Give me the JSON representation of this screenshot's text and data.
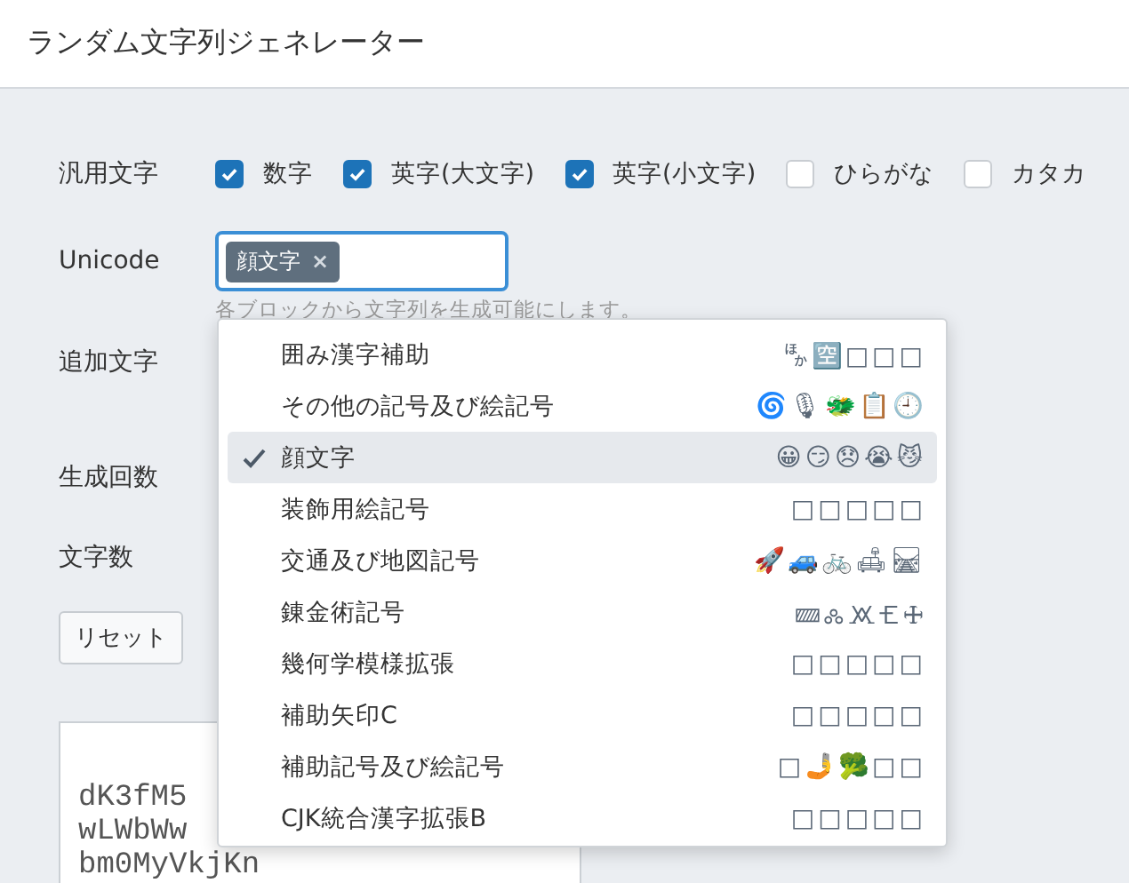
{
  "title": "ランダム文字列ジェネレーター",
  "general": {
    "label": "汎用文字",
    "options": [
      {
        "label": "数字",
        "checked": true
      },
      {
        "label": "英字(大文字)",
        "checked": true
      },
      {
        "label": "英字(小文字)",
        "checked": true
      },
      {
        "label": "ひらがな",
        "checked": false
      },
      {
        "label": "カタカ",
        "checked": false
      }
    ]
  },
  "unicode": {
    "label": "Unicode",
    "tags": [
      {
        "label": "顔文字",
        "remove": "×"
      }
    ],
    "hint": "各ブロックから文字列を生成可能にします。"
  },
  "extra_label": "追加文字",
  "count_label": "生成回数",
  "length_label": "文字数",
  "reset_button": "リセット",
  "output": [
    "dK3fM5",
    "wLWbWw",
    "bm0MyVkjKn"
  ],
  "dropdown": {
    "items": [
      {
        "label": "囲み漢字補助",
        "sample": "🈀🈳□□□",
        "selected": false
      },
      {
        "label": "その他の記号及び絵記号",
        "sample": "🌀🎙🐲📋🕘",
        "selected": false
      },
      {
        "label": "顔文字",
        "sample": "😀😏😞😭😼",
        "selected": true
      },
      {
        "label": "装飾用絵記号",
        "sample": "□□□□□",
        "selected": false
      },
      {
        "label": "交通及び地図記号",
        "sample": "🚀🚙🚲🛋🛤",
        "selected": false
      },
      {
        "label": "錬金術記号",
        "sample": "🝙🝆🝪🝗🜊",
        "selected": false
      },
      {
        "label": "幾何学模様拡張",
        "sample": "□□□□□",
        "selected": false
      },
      {
        "label": "補助矢印C",
        "sample": "□□□□□",
        "selected": false
      },
      {
        "label": "補助記号及び絵記号",
        "sample": "□🤳🥦□□",
        "selected": false
      },
      {
        "label": "CJK統合漢字拡張B",
        "sample": "□□□□□",
        "selected": false
      }
    ]
  }
}
